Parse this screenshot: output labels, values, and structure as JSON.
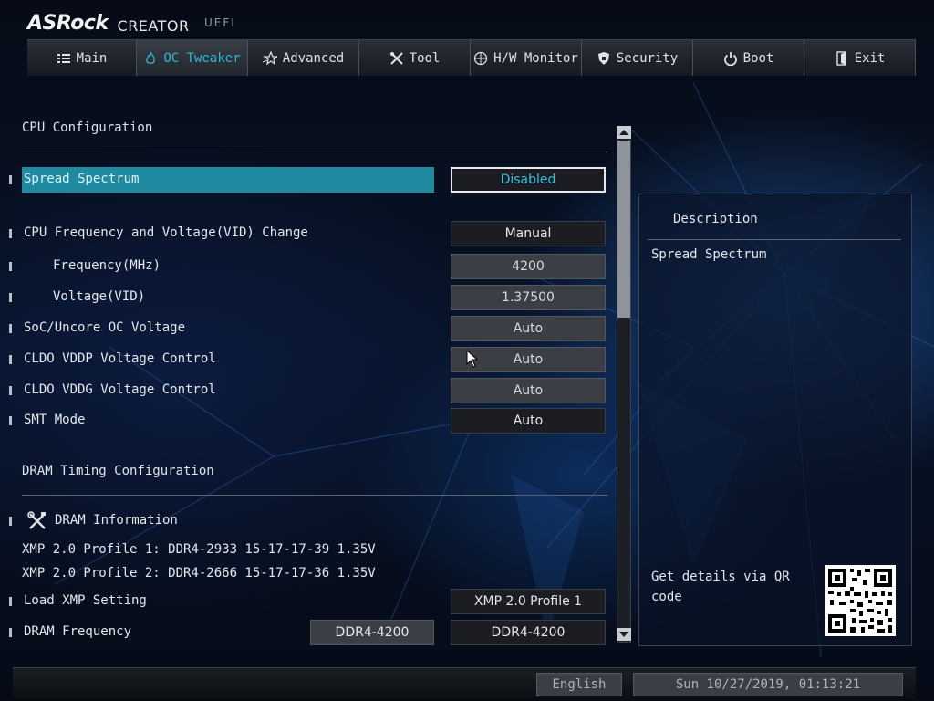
{
  "header": {
    "brand": "ASRock",
    "product": "CREATOR",
    "firmware": "UEFI"
  },
  "tabs": [
    {
      "label": "Main",
      "icon": "list-icon"
    },
    {
      "label": "OC Tweaker",
      "icon": "flame-icon",
      "active": true
    },
    {
      "label": "Advanced",
      "icon": "star-icon"
    },
    {
      "label": "Tool",
      "icon": "tools-icon"
    },
    {
      "label": "H/W Monitor",
      "icon": "monitor-icon"
    },
    {
      "label": "Security",
      "icon": "shield-icon"
    },
    {
      "label": "Boot",
      "icon": "power-icon"
    },
    {
      "label": "Exit",
      "icon": "exit-icon"
    }
  ],
  "cpu_section": {
    "title": "CPU Configuration"
  },
  "cpu_settings": [
    {
      "label": "Spread Spectrum",
      "value": "Disabled"
    },
    {
      "label": "CPU Frequency and Voltage(VID) Change",
      "value": "Manual"
    },
    {
      "label": "Frequency(MHz)",
      "value": "4200"
    },
    {
      "label": "Voltage(VID)",
      "value": "1.37500"
    },
    {
      "label": "SoC/Uncore OC Voltage",
      "value": "Auto"
    },
    {
      "label": "CLDO VDDP Voltage Control",
      "value": "Auto"
    },
    {
      "label": "CLDO VDDG Voltage Control",
      "value": "Auto"
    },
    {
      "label": "SMT Mode",
      "value": "Auto"
    }
  ],
  "dram_section": {
    "title": "DRAM Timing Configuration"
  },
  "dram_info": {
    "label": "DRAM Information",
    "lines": [
      "XMP 2.0 Profile 1: DDR4-2933 15-17-17-39 1.35V",
      "XMP 2.0 Profile 2: DDR4-2666 15-17-17-36 1.35V"
    ]
  },
  "dram_settings": [
    {
      "label": "Load XMP Setting",
      "value": "XMP 2.0 Profile 1"
    },
    {
      "label": "DRAM Frequency",
      "current": "DDR4-4200",
      "value": "DDR4-4200"
    }
  ],
  "description": {
    "title": "Description",
    "text": "Spread Spectrum",
    "qr_text": "Get details via QR code"
  },
  "footer": {
    "language": "English",
    "datetime": "Sun 10/27/2019, 01:13:21"
  }
}
